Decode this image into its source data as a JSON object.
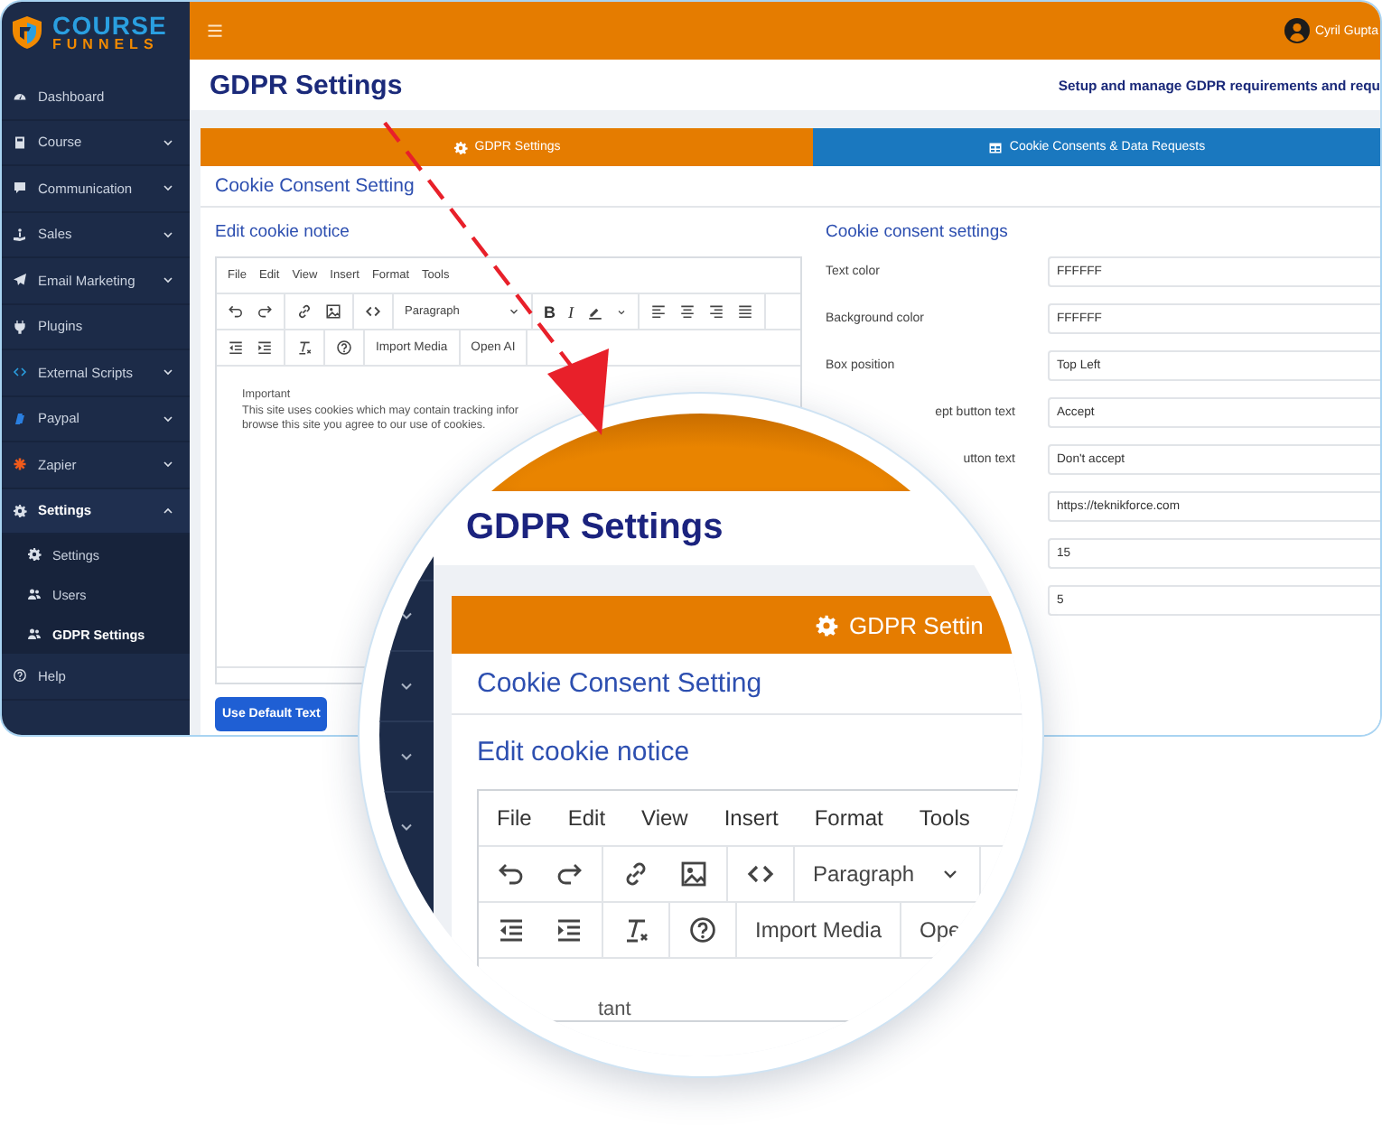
{
  "sidebar": {
    "logo": {
      "top": "COURSE",
      "bottom": "FUNNELS"
    },
    "items": [
      {
        "kind": "link",
        "label": "Dashboard"
      },
      {
        "kind": "menu",
        "label": "Course",
        "expanded": false
      },
      {
        "kind": "menu",
        "label": "Communication",
        "expanded": false
      },
      {
        "kind": "menu",
        "label": "Sales",
        "expanded": false
      },
      {
        "kind": "menu",
        "label": "Email Marketing",
        "expanded": false
      },
      {
        "kind": "link",
        "label": "Plugins"
      },
      {
        "kind": "menu",
        "label": "External Scripts",
        "expanded": false
      },
      {
        "kind": "menu",
        "label": "Paypal",
        "expanded": false
      },
      {
        "kind": "menu",
        "label": "Zapier",
        "expanded": false
      },
      {
        "kind": "menu",
        "label": "Settings",
        "expanded": true,
        "children": [
          {
            "label": "Settings",
            "selected": false
          },
          {
            "label": "Users",
            "selected": false
          },
          {
            "label": "GDPR Settings",
            "selected": true
          }
        ]
      },
      {
        "kind": "link",
        "label": "Help"
      }
    ]
  },
  "topbar": {
    "user": "Cyril Gupta"
  },
  "header": {
    "title": "GDPR Settings",
    "subtitle": "Setup and manage GDPR requirements and requ"
  },
  "tabs": [
    {
      "label": "GDPR Settings",
      "selected": true
    },
    {
      "label": "Cookie Consents & Data Requests",
      "selected": false
    }
  ],
  "card": {
    "title": "Cookie Consent Setting",
    "editor": {
      "heading": "Edit cookie notice",
      "menu": [
        "File",
        "Edit",
        "View",
        "Insert",
        "Format",
        "Tools"
      ],
      "block_format": "Paragraph",
      "bold": "B",
      "italic": "I",
      "buttons": [
        "Import Media",
        "Open AI"
      ],
      "content": [
        "Important",
        "This site uses cookies which may contain tracking infor",
        "browse this site you agree to our use of cookies."
      ]
    },
    "default_button": "Use Default Text",
    "settings": {
      "heading": "Cookie consent settings",
      "rows": [
        {
          "kind": "full",
          "label": "Text color",
          "value": "FFFFFF"
        },
        {
          "kind": "full",
          "label": "Background color",
          "value": "FFFFFF"
        },
        {
          "kind": "full",
          "label": "Box position",
          "value": "Top Left"
        },
        {
          "kind": "cut",
          "label": "ept button text",
          "value": "Accept"
        },
        {
          "kind": "cut",
          "label": "utton text",
          "value": "Don't accept"
        },
        {
          "kind": "cut",
          "value": "https://teknikforce.com"
        },
        {
          "kind": "cut",
          "value": "15"
        },
        {
          "kind": "cut",
          "value": "5"
        }
      ]
    }
  },
  "lens": {
    "title": "GDPR Settings",
    "tab": "GDPR Settin",
    "card_title": "Cookie Consent Setting",
    "editor_heading": "Edit cookie notice",
    "menu": [
      "File",
      "Edit",
      "View",
      "Insert",
      "Format",
      "Tools"
    ],
    "block_format": "Paragraph",
    "buttons": [
      "Import Media",
      "Ope"
    ],
    "content": "tant"
  }
}
